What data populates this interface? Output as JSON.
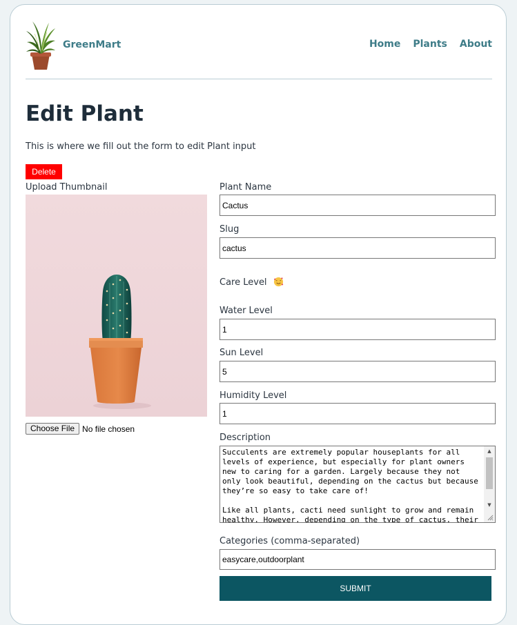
{
  "header": {
    "brand": "GreenMart",
    "logo_icon": "potted-palm-icon",
    "nav": [
      {
        "label": "Home"
      },
      {
        "label": "Plants"
      },
      {
        "label": "About"
      }
    ]
  },
  "page": {
    "title": "Edit Plant",
    "intro": "This is where we fill out the form to edit Plant input",
    "delete_label": "Delete"
  },
  "thumbnail": {
    "label": "Upload Thumbnail",
    "image_icon": "cactus-photo",
    "file_button": "Choose File",
    "file_status": "No file chosen"
  },
  "form": {
    "plant_name": {
      "label": "Plant Name",
      "value": "Cactus"
    },
    "slug": {
      "label": "Slug",
      "value": "cactus"
    },
    "care_level": {
      "label": "Care Level",
      "icon": "smiling-face-with-hearts-icon"
    },
    "water_level": {
      "label": "Water Level",
      "value": "1"
    },
    "sun_level": {
      "label": "Sun Level",
      "value": "5"
    },
    "humidity_level": {
      "label": "Humidity Level",
      "value": "1"
    },
    "description": {
      "label": "Description",
      "value": "Succulents are extremely popular houseplants for all levels of experience, but especially for plant owners new to caring for a garden. Largely because they not only look beautiful, depending on the cactus but because they’re so easy to take care of!\n\nLike all plants, cacti need sunlight to grow and remain healthy. However, depending on the type of cactus, their"
    },
    "categories": {
      "label": "Categories (comma-separated)",
      "value": "easycare,outdoorplant"
    },
    "submit_label": "SUBMIT"
  },
  "colors": {
    "accent": "#3e7c88",
    "submit_bg": "#0c5662",
    "delete_bg": "#ff0000",
    "heading": "#1e2d3a"
  }
}
